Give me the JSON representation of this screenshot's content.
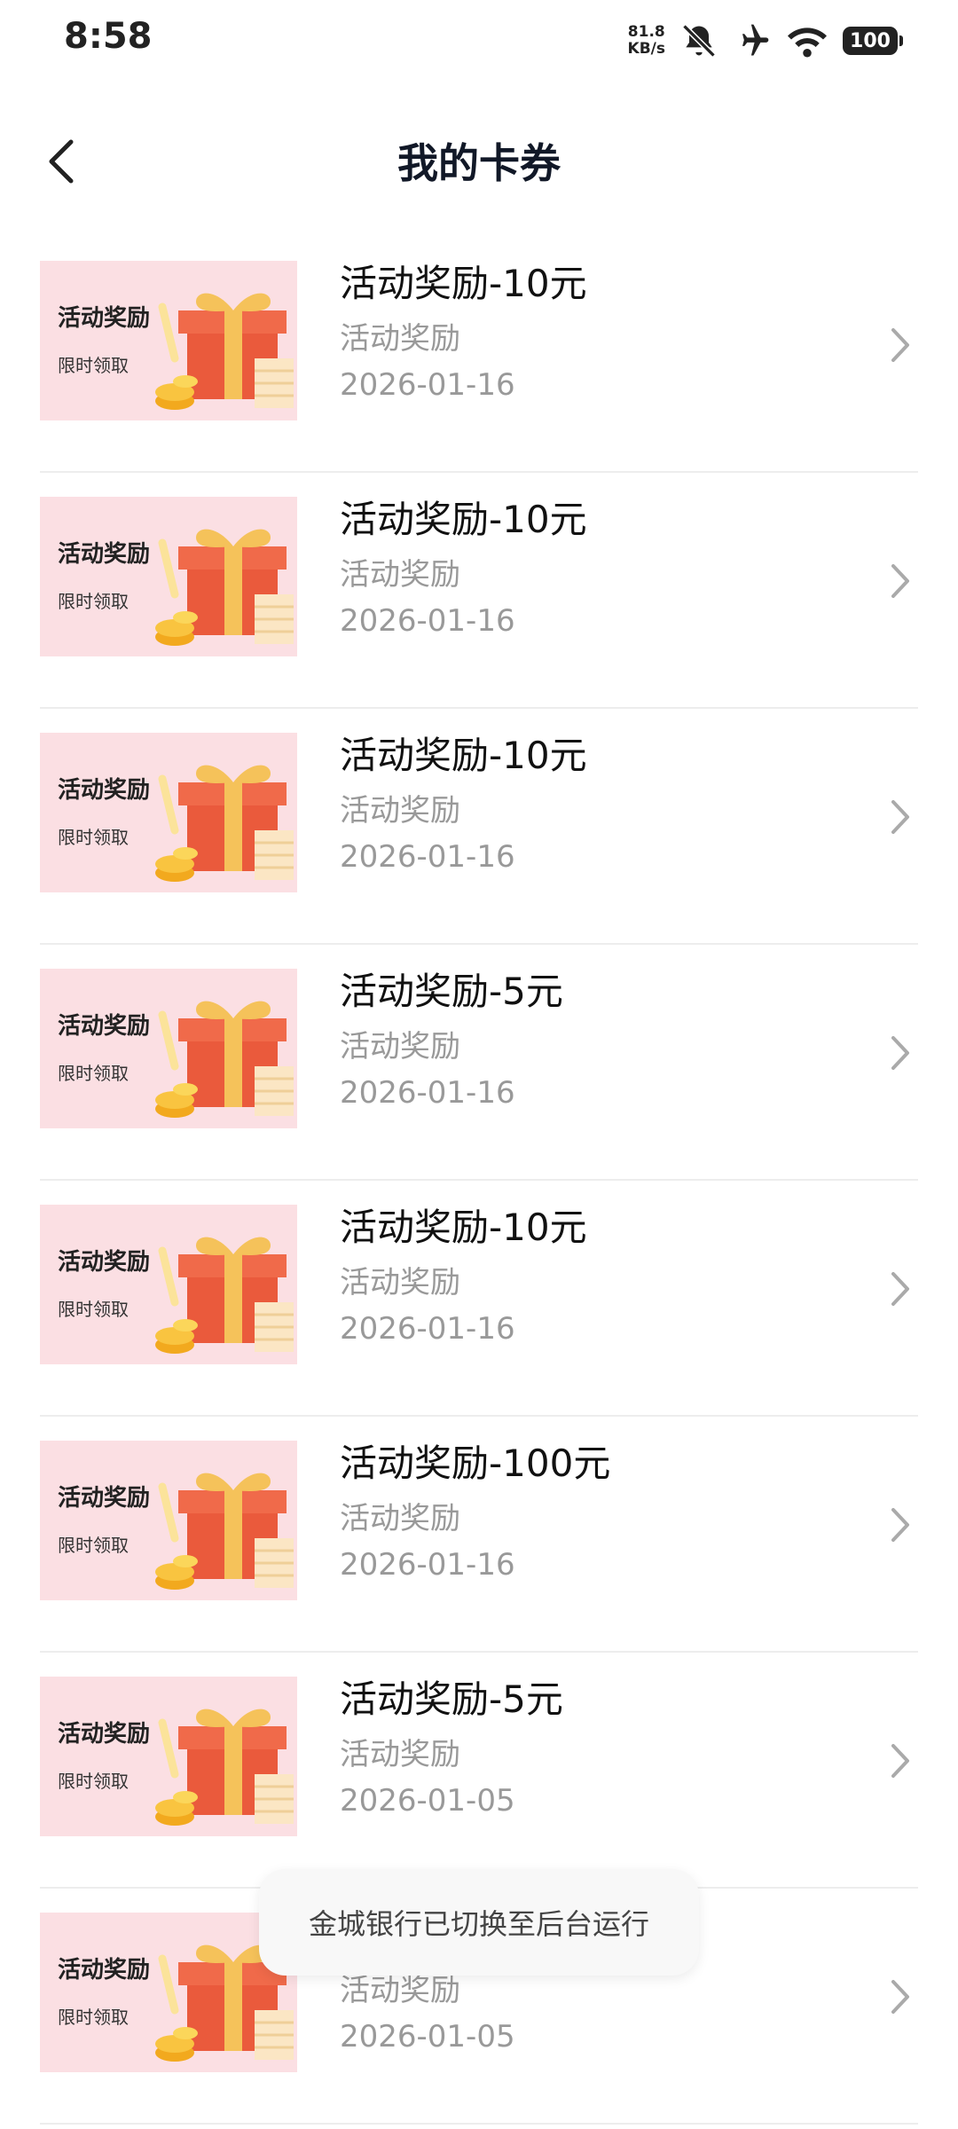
{
  "status_bar": {
    "time": "8:58",
    "net_speed_value": "81.8",
    "net_speed_unit": "KB/s",
    "battery": "100"
  },
  "header": {
    "title": "我的卡券"
  },
  "coupons": [
    {
      "thumb_title": "活动奖励",
      "thumb_sub": "限时领取",
      "title": "活动奖励-10元",
      "subtitle": "活动奖励",
      "date": "2026-01-16"
    },
    {
      "thumb_title": "活动奖励",
      "thumb_sub": "限时领取",
      "title": "活动奖励-10元",
      "subtitle": "活动奖励",
      "date": "2026-01-16"
    },
    {
      "thumb_title": "活动奖励",
      "thumb_sub": "限时领取",
      "title": "活动奖励-10元",
      "subtitle": "活动奖励",
      "date": "2026-01-16"
    },
    {
      "thumb_title": "活动奖励",
      "thumb_sub": "限时领取",
      "title": "活动奖励-5元",
      "subtitle": "活动奖励",
      "date": "2026-01-16"
    },
    {
      "thumb_title": "活动奖励",
      "thumb_sub": "限时领取",
      "title": "活动奖励-10元",
      "subtitle": "活动奖励",
      "date": "2026-01-16"
    },
    {
      "thumb_title": "活动奖励",
      "thumb_sub": "限时领取",
      "title": "活动奖励-100元",
      "subtitle": "活动奖励",
      "date": "2026-01-16"
    },
    {
      "thumb_title": "活动奖励",
      "thumb_sub": "限时领取",
      "title": "活动奖励-5元",
      "subtitle": "活动奖励",
      "date": "2026-01-05"
    },
    {
      "thumb_title": "活动奖励",
      "thumb_sub": "限时领取",
      "title": "",
      "subtitle": "活动奖励",
      "date": "2026-01-05"
    }
  ],
  "toast": {
    "message": "金城银行已切换至后台运行"
  },
  "colors": {
    "thumb_background": "#fbdfe3",
    "gift_red": "#ea5a3c",
    "ribbon_gold": "#f5c25a",
    "secondary_text": "#999999"
  },
  "icons": {
    "back": "chevron-left-icon",
    "row_arrow": "chevron-right-icon",
    "silent": "bell-off-icon",
    "airplane": "airplane-icon",
    "wifi": "wifi-icon"
  }
}
